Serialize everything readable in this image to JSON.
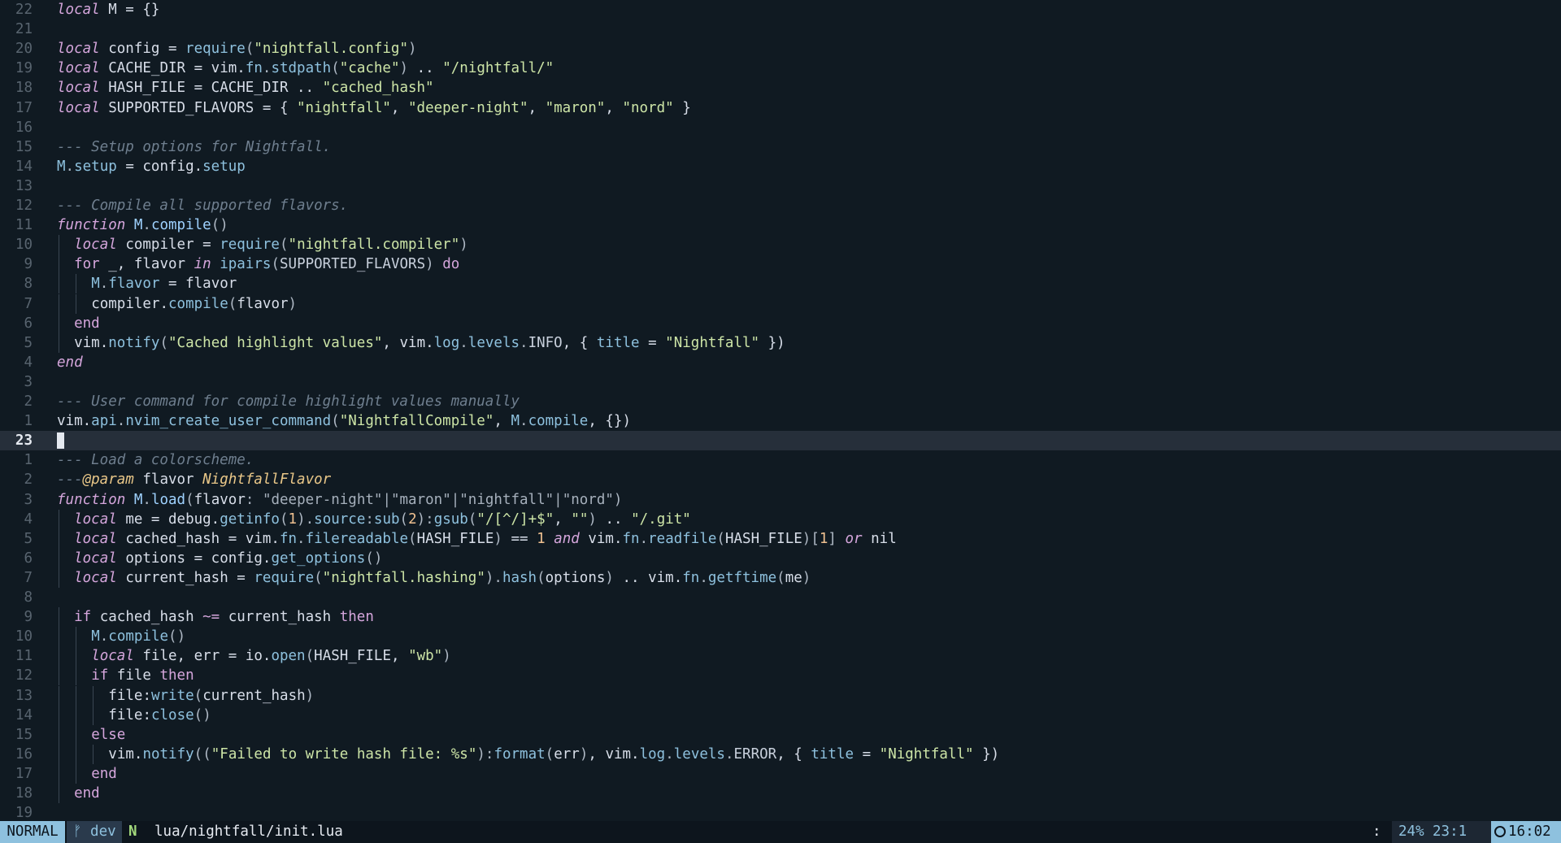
{
  "editor": {
    "cursor_line_number": "23",
    "lines": [
      {
        "n": "22",
        "code": [
          [
            "k",
            "local"
          ],
          [
            "v",
            " M = {}"
          ]
        ]
      },
      {
        "n": "21",
        "code": []
      },
      {
        "n": "20",
        "code": [
          [
            "k",
            "local"
          ],
          [
            "v",
            " config = "
          ],
          [
            "f",
            "require"
          ],
          [
            "p",
            "("
          ],
          [
            "s",
            "\"nightfall.config\""
          ],
          [
            "p",
            ")"
          ]
        ]
      },
      {
        "n": "19",
        "code": [
          [
            "k",
            "local"
          ],
          [
            "v",
            " CACHE_DIR = vim."
          ],
          [
            "f",
            "fn"
          ],
          [
            "p",
            "."
          ],
          [
            "f",
            "stdpath"
          ],
          [
            "p",
            "("
          ],
          [
            "s",
            "\"cache\""
          ],
          [
            "p",
            ")"
          ],
          [
            "v",
            " .. "
          ],
          [
            "s",
            "\"/nightfall/\""
          ]
        ]
      },
      {
        "n": "18",
        "code": [
          [
            "k",
            "local"
          ],
          [
            "v",
            " HASH_FILE = CACHE_DIR .. "
          ],
          [
            "s",
            "\"cached_hash\""
          ]
        ]
      },
      {
        "n": "17",
        "code": [
          [
            "k",
            "local"
          ],
          [
            "v",
            " SUPPORTED_FLAVORS = { "
          ],
          [
            "s",
            "\"nightfall\""
          ],
          [
            "v",
            ", "
          ],
          [
            "s",
            "\"deeper-night\""
          ],
          [
            "v",
            ", "
          ],
          [
            "s",
            "\"maron\""
          ],
          [
            "v",
            ", "
          ],
          [
            "s",
            "\"nord\""
          ],
          [
            "v",
            " }"
          ]
        ]
      },
      {
        "n": "16",
        "code": []
      },
      {
        "n": "15",
        "code": [
          [
            "c",
            "--- Setup options for Nightfall."
          ]
        ]
      },
      {
        "n": "14",
        "code": [
          [
            "f",
            "M"
          ],
          [
            "p",
            "."
          ],
          [
            "f",
            "setup"
          ],
          [
            "v",
            " = config."
          ],
          [
            "f",
            "setup"
          ]
        ]
      },
      {
        "n": "13",
        "code": []
      },
      {
        "n": "12",
        "code": [
          [
            "c",
            "--- Compile all supported flavors."
          ]
        ]
      },
      {
        "n": "11",
        "code": [
          [
            "k",
            "function"
          ],
          [
            "v",
            " "
          ],
          [
            "fd",
            "M"
          ],
          [
            "p",
            "."
          ],
          [
            "fd",
            "compile"
          ],
          [
            "p",
            "()"
          ]
        ]
      },
      {
        "n": "10",
        "indent": 1,
        "code": [
          [
            "k",
            "local"
          ],
          [
            "v",
            " compiler = "
          ],
          [
            "f",
            "require"
          ],
          [
            "p",
            "("
          ],
          [
            "s",
            "\"nightfall.compiler\""
          ],
          [
            "p",
            ")"
          ]
        ]
      },
      {
        "n": "9",
        "indent": 1,
        "code": [
          [
            "kn",
            "for"
          ],
          [
            "v",
            " _, flavor "
          ],
          [
            "k",
            "in"
          ],
          [
            "v",
            " "
          ],
          [
            "f",
            "ipairs"
          ],
          [
            "p",
            "("
          ],
          [
            "cn",
            "SUPPORTED_FLAVORS"
          ],
          [
            "p",
            ")"
          ],
          [
            "v",
            " "
          ],
          [
            "kn",
            "do"
          ]
        ]
      },
      {
        "n": "8",
        "indent": 2,
        "code": [
          [
            "f",
            "M"
          ],
          [
            "p",
            "."
          ],
          [
            "f",
            "flavor"
          ],
          [
            "v",
            " = flavor"
          ]
        ]
      },
      {
        "n": "7",
        "indent": 2,
        "code": [
          [
            "v",
            "compiler."
          ],
          [
            "f",
            "compile"
          ],
          [
            "p",
            "("
          ],
          [
            "v",
            "flavor"
          ],
          [
            "p",
            ")"
          ]
        ]
      },
      {
        "n": "6",
        "indent": 1,
        "code": [
          [
            "kn",
            "end"
          ]
        ]
      },
      {
        "n": "5",
        "indent": 1,
        "code": [
          [
            "v",
            "vim."
          ],
          [
            "f",
            "notify"
          ],
          [
            "p",
            "("
          ],
          [
            "s",
            "\"Cached highlight values\""
          ],
          [
            "v",
            ", vim."
          ],
          [
            "f",
            "log"
          ],
          [
            "p",
            "."
          ],
          [
            "f",
            "levels"
          ],
          [
            "p",
            "."
          ],
          [
            "cn",
            "INFO"
          ],
          [
            "v",
            ", { "
          ],
          [
            "f",
            "title"
          ],
          [
            "v",
            " = "
          ],
          [
            "s",
            "\"Nightfall\""
          ],
          [
            "v",
            " })"
          ]
        ]
      },
      {
        "n": "4",
        "code": [
          [
            "k",
            "end"
          ]
        ]
      },
      {
        "n": "3",
        "code": []
      },
      {
        "n": "2",
        "code": [
          [
            "c",
            "--- User command for compile highlight values manually"
          ]
        ]
      },
      {
        "n": "1",
        "code": [
          [
            "v",
            "vim."
          ],
          [
            "f",
            "api"
          ],
          [
            "p",
            "."
          ],
          [
            "f",
            "nvim_create_user_command"
          ],
          [
            "p",
            "("
          ],
          [
            "s",
            "\"NightfallCompile\""
          ],
          [
            "v",
            ", "
          ],
          [
            "f",
            "M"
          ],
          [
            "p",
            "."
          ],
          [
            "f",
            "compile"
          ],
          [
            "v",
            ", {})"
          ]
        ]
      },
      {
        "n": "23",
        "current": true,
        "code": []
      },
      {
        "n": "1",
        "code": [
          [
            "c",
            "--- Load a colorscheme."
          ]
        ]
      },
      {
        "n": "2",
        "code": [
          [
            "c",
            "---"
          ],
          [
            "t",
            "@param"
          ],
          [
            "c",
            " "
          ],
          [
            "v",
            "flavor"
          ],
          [
            "c",
            " "
          ],
          [
            "t",
            "NightfallFlavor"
          ]
        ]
      },
      {
        "n": "3",
        "code": [
          [
            "k",
            "function"
          ],
          [
            "v",
            " "
          ],
          [
            "fd",
            "M"
          ],
          [
            "p",
            "."
          ],
          [
            "fd",
            "load"
          ],
          [
            "p",
            "("
          ],
          [
            "v",
            "flavor"
          ],
          [
            "sd",
            ": "
          ],
          [
            "sd",
            "\"deeper-night\"|\"maron\"|\"nightfall\"|\"nord\""
          ],
          [
            "p",
            ")"
          ]
        ]
      },
      {
        "n": "4",
        "indent": 1,
        "code": [
          [
            "k",
            "local"
          ],
          [
            "v",
            " me = debug."
          ],
          [
            "f",
            "getinfo"
          ],
          [
            "p",
            "("
          ],
          [
            "n",
            "1"
          ],
          [
            "p",
            ")."
          ],
          [
            "f",
            "source"
          ],
          [
            "p",
            ":"
          ],
          [
            "f",
            "sub"
          ],
          [
            "p",
            "("
          ],
          [
            "n",
            "2"
          ],
          [
            "p",
            "):"
          ],
          [
            "f",
            "gsub"
          ],
          [
            "p",
            "("
          ],
          [
            "s",
            "\"/[^/]+$\""
          ],
          [
            "v",
            ", "
          ],
          [
            "s",
            "\"\""
          ],
          [
            "p",
            ")"
          ],
          [
            "v",
            " .. "
          ],
          [
            "s",
            "\"/.git\""
          ]
        ]
      },
      {
        "n": "5",
        "indent": 1,
        "code": [
          [
            "k",
            "local"
          ],
          [
            "v",
            " cached_hash = vim."
          ],
          [
            "f",
            "fn"
          ],
          [
            "p",
            "."
          ],
          [
            "f",
            "filereadable"
          ],
          [
            "p",
            "("
          ],
          [
            "v",
            "HASH_FILE"
          ],
          [
            "p",
            ")"
          ],
          [
            "v",
            " == "
          ],
          [
            "n",
            "1"
          ],
          [
            "v",
            " "
          ],
          [
            "k",
            "and"
          ],
          [
            "v",
            " vim."
          ],
          [
            "f",
            "fn"
          ],
          [
            "p",
            "."
          ],
          [
            "f",
            "readfile"
          ],
          [
            "p",
            "("
          ],
          [
            "v",
            "HASH_FILE"
          ],
          [
            "p",
            ")["
          ],
          [
            "n",
            "1"
          ],
          [
            "p",
            "]"
          ],
          [
            "v",
            " "
          ],
          [
            "k",
            "or"
          ],
          [
            "v",
            " nil"
          ]
        ]
      },
      {
        "n": "6",
        "indent": 1,
        "code": [
          [
            "k",
            "local"
          ],
          [
            "v",
            " options = config."
          ],
          [
            "f",
            "get_options"
          ],
          [
            "p",
            "()"
          ]
        ]
      },
      {
        "n": "7",
        "indent": 1,
        "code": [
          [
            "k",
            "local"
          ],
          [
            "v",
            " current_hash = "
          ],
          [
            "f",
            "require"
          ],
          [
            "p",
            "("
          ],
          [
            "s",
            "\"nightfall.hashing\""
          ],
          [
            "p",
            ")."
          ],
          [
            "f",
            "hash"
          ],
          [
            "p",
            "("
          ],
          [
            "v",
            "options"
          ],
          [
            "p",
            ")"
          ],
          [
            "v",
            " .. vim."
          ],
          [
            "f",
            "fn"
          ],
          [
            "p",
            "."
          ],
          [
            "f",
            "getftime"
          ],
          [
            "p",
            "("
          ],
          [
            "v",
            "me"
          ],
          [
            "p",
            ")"
          ]
        ]
      },
      {
        "n": "8",
        "code": []
      },
      {
        "n": "9",
        "indent": 1,
        "code": [
          [
            "kn",
            "if"
          ],
          [
            "v",
            " cached_hash "
          ],
          [
            "kn",
            "~="
          ],
          [
            "v",
            " current_hash "
          ],
          [
            "kn",
            "then"
          ]
        ]
      },
      {
        "n": "10",
        "indent": 2,
        "code": [
          [
            "f",
            "M"
          ],
          [
            "p",
            "."
          ],
          [
            "f",
            "compile"
          ],
          [
            "p",
            "()"
          ]
        ]
      },
      {
        "n": "11",
        "indent": 2,
        "code": [
          [
            "k",
            "local"
          ],
          [
            "v",
            " file, err = io."
          ],
          [
            "f",
            "open"
          ],
          [
            "p",
            "("
          ],
          [
            "v",
            "HASH_FILE"
          ],
          [
            "v",
            ", "
          ],
          [
            "s",
            "\"wb\""
          ],
          [
            "p",
            ")"
          ]
        ]
      },
      {
        "n": "12",
        "indent": 2,
        "code": [
          [
            "kn",
            "if"
          ],
          [
            "v",
            " file "
          ],
          [
            "kn",
            "then"
          ]
        ]
      },
      {
        "n": "13",
        "indent": 3,
        "code": [
          [
            "v",
            "file:"
          ],
          [
            "f",
            "write"
          ],
          [
            "p",
            "("
          ],
          [
            "v",
            "current_hash"
          ],
          [
            "p",
            ")"
          ]
        ]
      },
      {
        "n": "14",
        "indent": 3,
        "code": [
          [
            "v",
            "file:"
          ],
          [
            "f",
            "close"
          ],
          [
            "p",
            "()"
          ]
        ]
      },
      {
        "n": "15",
        "indent": 2,
        "code": [
          [
            "kn",
            "else"
          ]
        ]
      },
      {
        "n": "16",
        "indent": 3,
        "code": [
          [
            "v",
            "vim."
          ],
          [
            "f",
            "notify"
          ],
          [
            "p",
            "(("
          ],
          [
            "s",
            "\"Failed to write hash file: %s\""
          ],
          [
            "p",
            "):"
          ],
          [
            "f",
            "format"
          ],
          [
            "p",
            "("
          ],
          [
            "v",
            "err"
          ],
          [
            "p",
            ")"
          ],
          [
            "v",
            ", vim."
          ],
          [
            "f",
            "log"
          ],
          [
            "p",
            "."
          ],
          [
            "f",
            "levels"
          ],
          [
            "p",
            "."
          ],
          [
            "cn",
            "ERROR"
          ],
          [
            "v",
            ", { "
          ],
          [
            "f",
            "title"
          ],
          [
            "v",
            " = "
          ],
          [
            "s",
            "\"Nightfall\""
          ],
          [
            "v",
            " })"
          ]
        ]
      },
      {
        "n": "17",
        "indent": 2,
        "code": [
          [
            "kn",
            "end"
          ]
        ]
      },
      {
        "n": "18",
        "indent": 1,
        "code": [
          [
            "kn",
            "end"
          ]
        ]
      },
      {
        "n": "19",
        "code": []
      }
    ]
  },
  "statusline": {
    "mode": "NORMAL",
    "branch_icon": "ᚠ",
    "branch": "dev",
    "nvim_icon": "N",
    "file": "lua/nightfall/init.lua",
    "colon": ":",
    "percent": "24%",
    "position": "23:1",
    "time": "16:02"
  },
  "colors": {
    "background": "#101a22",
    "cursorline": "#262f3a",
    "accent": "#8ec1de"
  }
}
